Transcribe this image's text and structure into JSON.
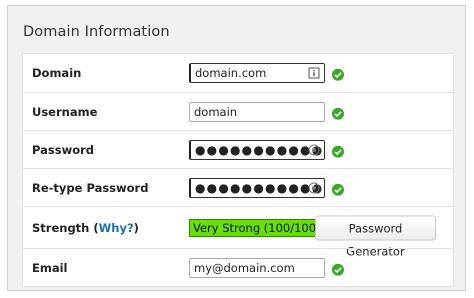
{
  "panel": {
    "title": "Domain Information"
  },
  "rows": {
    "domain": {
      "label": "Domain",
      "value": "domain.com"
    },
    "username": {
      "label": "Username",
      "value": "domain"
    },
    "password": {
      "label": "Password",
      "value": "●●●●●●●●●●●●●●●"
    },
    "retype": {
      "label": "Re-type Password",
      "value": "●●●●●●●●●●●●●●●"
    },
    "strength": {
      "label_prefix": "Strength (",
      "link": "Why?",
      "label_suffix": ")",
      "value": "Very Strong (100/100)",
      "generator_button": "Password Generator",
      "meter_color": "#66e000"
    },
    "email": {
      "label": "Email",
      "value": "my@domain.com"
    }
  },
  "colors": {
    "valid_check": "#3aa829",
    "link": "#1a6fb8"
  },
  "icons": {
    "valid": "check-circle-icon",
    "domain_field": "info-square-icon",
    "password_field": "reveal-password-icon"
  }
}
